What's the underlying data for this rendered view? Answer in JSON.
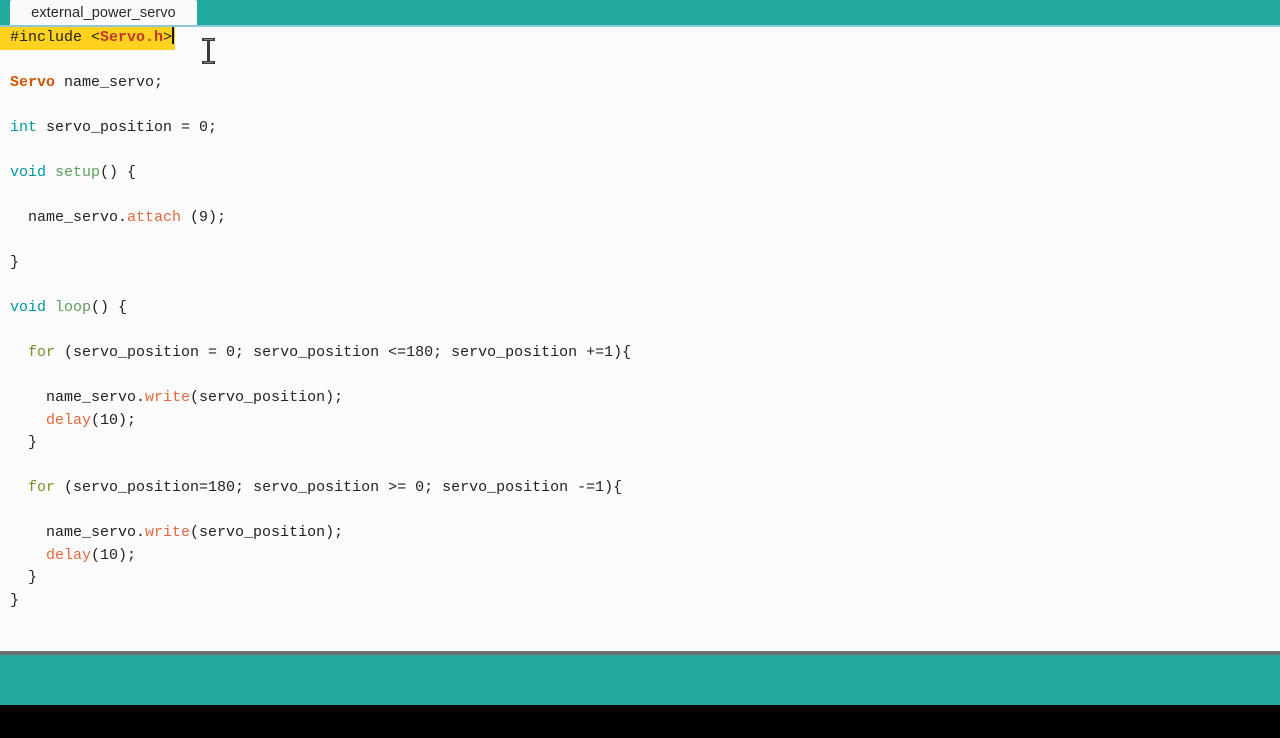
{
  "window": {
    "accent_teal": "#21ab9e",
    "editor_background": "#fbfbfb",
    "highlight_yellow": "#ffd21f",
    "underline_blue": "#8fc6d8"
  },
  "tabbar": {
    "active_tab_label": "external_power_servo"
  },
  "editor": {
    "cursor_icon": "text-ibeam-icon",
    "caret_visible": true,
    "highlighted_line_index": 0,
    "lines": [
      {
        "highlighted": true,
        "tokens": [
          {
            "text": "#include ",
            "type": "pre"
          },
          {
            "text": "<",
            "type": "plain"
          },
          {
            "text": "Servo.h",
            "type": "lib"
          },
          {
            "text": ">",
            "type": "plain"
          }
        ]
      },
      {
        "highlighted": false,
        "tokens": []
      },
      {
        "highlighted": false,
        "tokens": [
          {
            "text": "Servo",
            "type": "class"
          },
          {
            "text": " name_servo;",
            "type": "plain"
          }
        ]
      },
      {
        "highlighted": false,
        "tokens": []
      },
      {
        "highlighted": false,
        "tokens": [
          {
            "text": "int",
            "type": "type"
          },
          {
            "text": " servo_position = 0;",
            "type": "plain"
          }
        ]
      },
      {
        "highlighted": false,
        "tokens": []
      },
      {
        "highlighted": false,
        "tokens": [
          {
            "text": "void",
            "type": "type"
          },
          {
            "text": " ",
            "type": "plain"
          },
          {
            "text": "setup",
            "type": "func"
          },
          {
            "text": "() {",
            "type": "plain"
          }
        ]
      },
      {
        "highlighted": false,
        "tokens": []
      },
      {
        "highlighted": false,
        "tokens": [
          {
            "text": "  name_servo.",
            "type": "plain"
          },
          {
            "text": "attach",
            "type": "method"
          },
          {
            "text": " (9);",
            "type": "plain"
          }
        ]
      },
      {
        "highlighted": false,
        "tokens": []
      },
      {
        "highlighted": false,
        "tokens": [
          {
            "text": "}",
            "type": "plain"
          }
        ]
      },
      {
        "highlighted": false,
        "tokens": []
      },
      {
        "highlighted": false,
        "tokens": [
          {
            "text": "void",
            "type": "type"
          },
          {
            "text": " ",
            "type": "plain"
          },
          {
            "text": "loop",
            "type": "func"
          },
          {
            "text": "() {",
            "type": "plain"
          }
        ]
      },
      {
        "highlighted": false,
        "tokens": []
      },
      {
        "highlighted": false,
        "tokens": [
          {
            "text": "  ",
            "type": "plain"
          },
          {
            "text": "for",
            "type": "kw"
          },
          {
            "text": " (servo_position = 0; servo_position <=180; servo_position +=1){",
            "type": "plain"
          }
        ]
      },
      {
        "highlighted": false,
        "tokens": []
      },
      {
        "highlighted": false,
        "tokens": [
          {
            "text": "    name_servo.",
            "type": "plain"
          },
          {
            "text": "write",
            "type": "method"
          },
          {
            "text": "(servo_position);",
            "type": "plain"
          }
        ]
      },
      {
        "highlighted": false,
        "tokens": [
          {
            "text": "    ",
            "type": "plain"
          },
          {
            "text": "delay",
            "type": "method"
          },
          {
            "text": "(10);",
            "type": "plain"
          }
        ]
      },
      {
        "highlighted": false,
        "tokens": [
          {
            "text": "  }",
            "type": "plain"
          }
        ]
      },
      {
        "highlighted": false,
        "tokens": []
      },
      {
        "highlighted": false,
        "tokens": [
          {
            "text": "  ",
            "type": "plain"
          },
          {
            "text": "for",
            "type": "kw"
          },
          {
            "text": " (servo_position=180; servo_position >= 0; servo_position -=1){",
            "type": "plain"
          }
        ]
      },
      {
        "highlighted": false,
        "tokens": []
      },
      {
        "highlighted": false,
        "tokens": [
          {
            "text": "    name_servo.",
            "type": "plain"
          },
          {
            "text": "write",
            "type": "method"
          },
          {
            "text": "(servo_position);",
            "type": "plain"
          }
        ]
      },
      {
        "highlighted": false,
        "tokens": [
          {
            "text": "    ",
            "type": "plain"
          },
          {
            "text": "delay",
            "type": "method"
          },
          {
            "text": "(10);",
            "type": "plain"
          }
        ]
      },
      {
        "highlighted": false,
        "tokens": [
          {
            "text": "  }",
            "type": "plain"
          }
        ]
      },
      {
        "highlighted": false,
        "tokens": [
          {
            "text": "}",
            "type": "plain"
          }
        ]
      }
    ]
  },
  "statusbar": {
    "message": ""
  }
}
